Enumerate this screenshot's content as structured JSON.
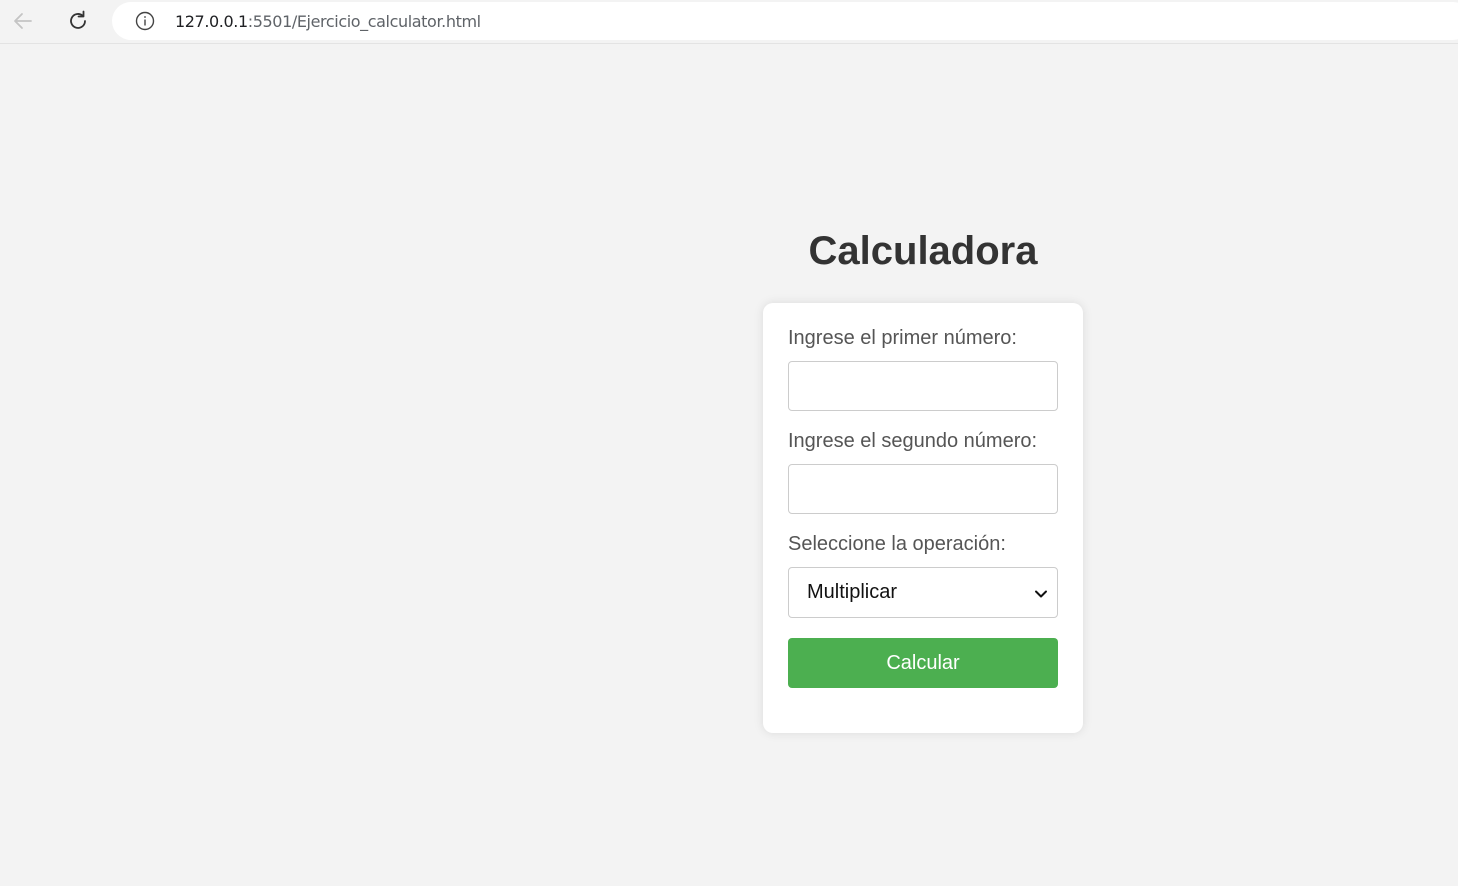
{
  "browser": {
    "url_host": "127.0.0.1",
    "url_rest": ":5501/Ejercicio_calculator.html",
    "icons": {
      "back": "back-arrow-icon",
      "reload": "reload-icon",
      "info": "info-icon"
    }
  },
  "page": {
    "title": "Calculadora"
  },
  "form": {
    "first_label": "Ingrese el primer número:",
    "first_value": "",
    "second_label": "Ingrese el segundo número:",
    "second_value": "",
    "operation_label": "Seleccione la operación:",
    "operation_selected": "Multiplicar",
    "calculate_label": "Calcular"
  },
  "colors": {
    "background": "#f3f3f3",
    "card": "#ffffff",
    "accent_button": "#4caf50",
    "title_text": "#333333",
    "label_text": "#555555"
  }
}
